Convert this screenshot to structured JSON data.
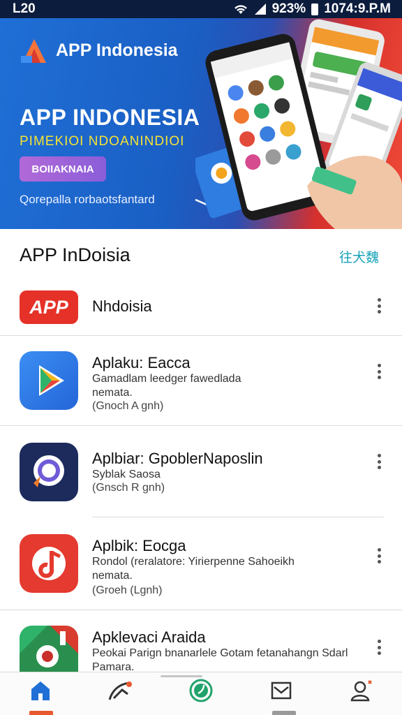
{
  "status_bar": {
    "left": "L20",
    "battery_percent": "923%",
    "time": "1074:9.P.M"
  },
  "banner": {
    "app_name": "APP Indonesia",
    "title": "APP INDONESIA",
    "subtitle": "PIMEKIOI NDOANINDIOI",
    "cta_label": "BOIIAKNAIA",
    "caption": "Qorepalla rorbaotsfantard",
    "colors": {
      "blue": "#1a5fc4",
      "red": "#d6302d",
      "subtitle": "#f6e233",
      "cta": "#a667d8"
    }
  },
  "section": {
    "title": "APP InDoisia",
    "link": "往犬魏",
    "link_color": "#17a2b8"
  },
  "apps": [
    {
      "name": "Nhdoisia",
      "desc": "",
      "meta": "",
      "icon": "app-logo-icon",
      "icon_text": "APP"
    },
    {
      "name": "Aplaku: Eacca",
      "desc": "Gamadlam leedger fawedlada\nnemata.",
      "meta": "(Gnoch A gnh)",
      "icon": "play-store-icon"
    },
    {
      "name": "Aplbiar: GpoblerNaposlin",
      "desc": "Syblak Saosa",
      "meta": "(Gnsch R gnh)",
      "icon": "compass-icon"
    },
    {
      "name": "Aplbik: Eocga",
      "desc": "Rondol (reralatore: Yirierpenne Sahoeikh\nnemata.",
      "meta": "(Groeh (Lgnh)",
      "icon": "music-icon"
    },
    {
      "name": "Apklevaci Araida",
      "desc": "Peokai Parign bnanarlele Gotam fetanahangn Sdarl\nPamara.",
      "meta": "",
      "icon": "game-icon"
    }
  ],
  "bottom_nav": [
    {
      "name": "home",
      "icon": "home-icon"
    },
    {
      "name": "explore",
      "icon": "explore-icon"
    },
    {
      "name": "apps",
      "icon": "apps-icon"
    },
    {
      "name": "messages",
      "icon": "mail-icon"
    },
    {
      "name": "profile",
      "icon": "profile-icon"
    }
  ]
}
